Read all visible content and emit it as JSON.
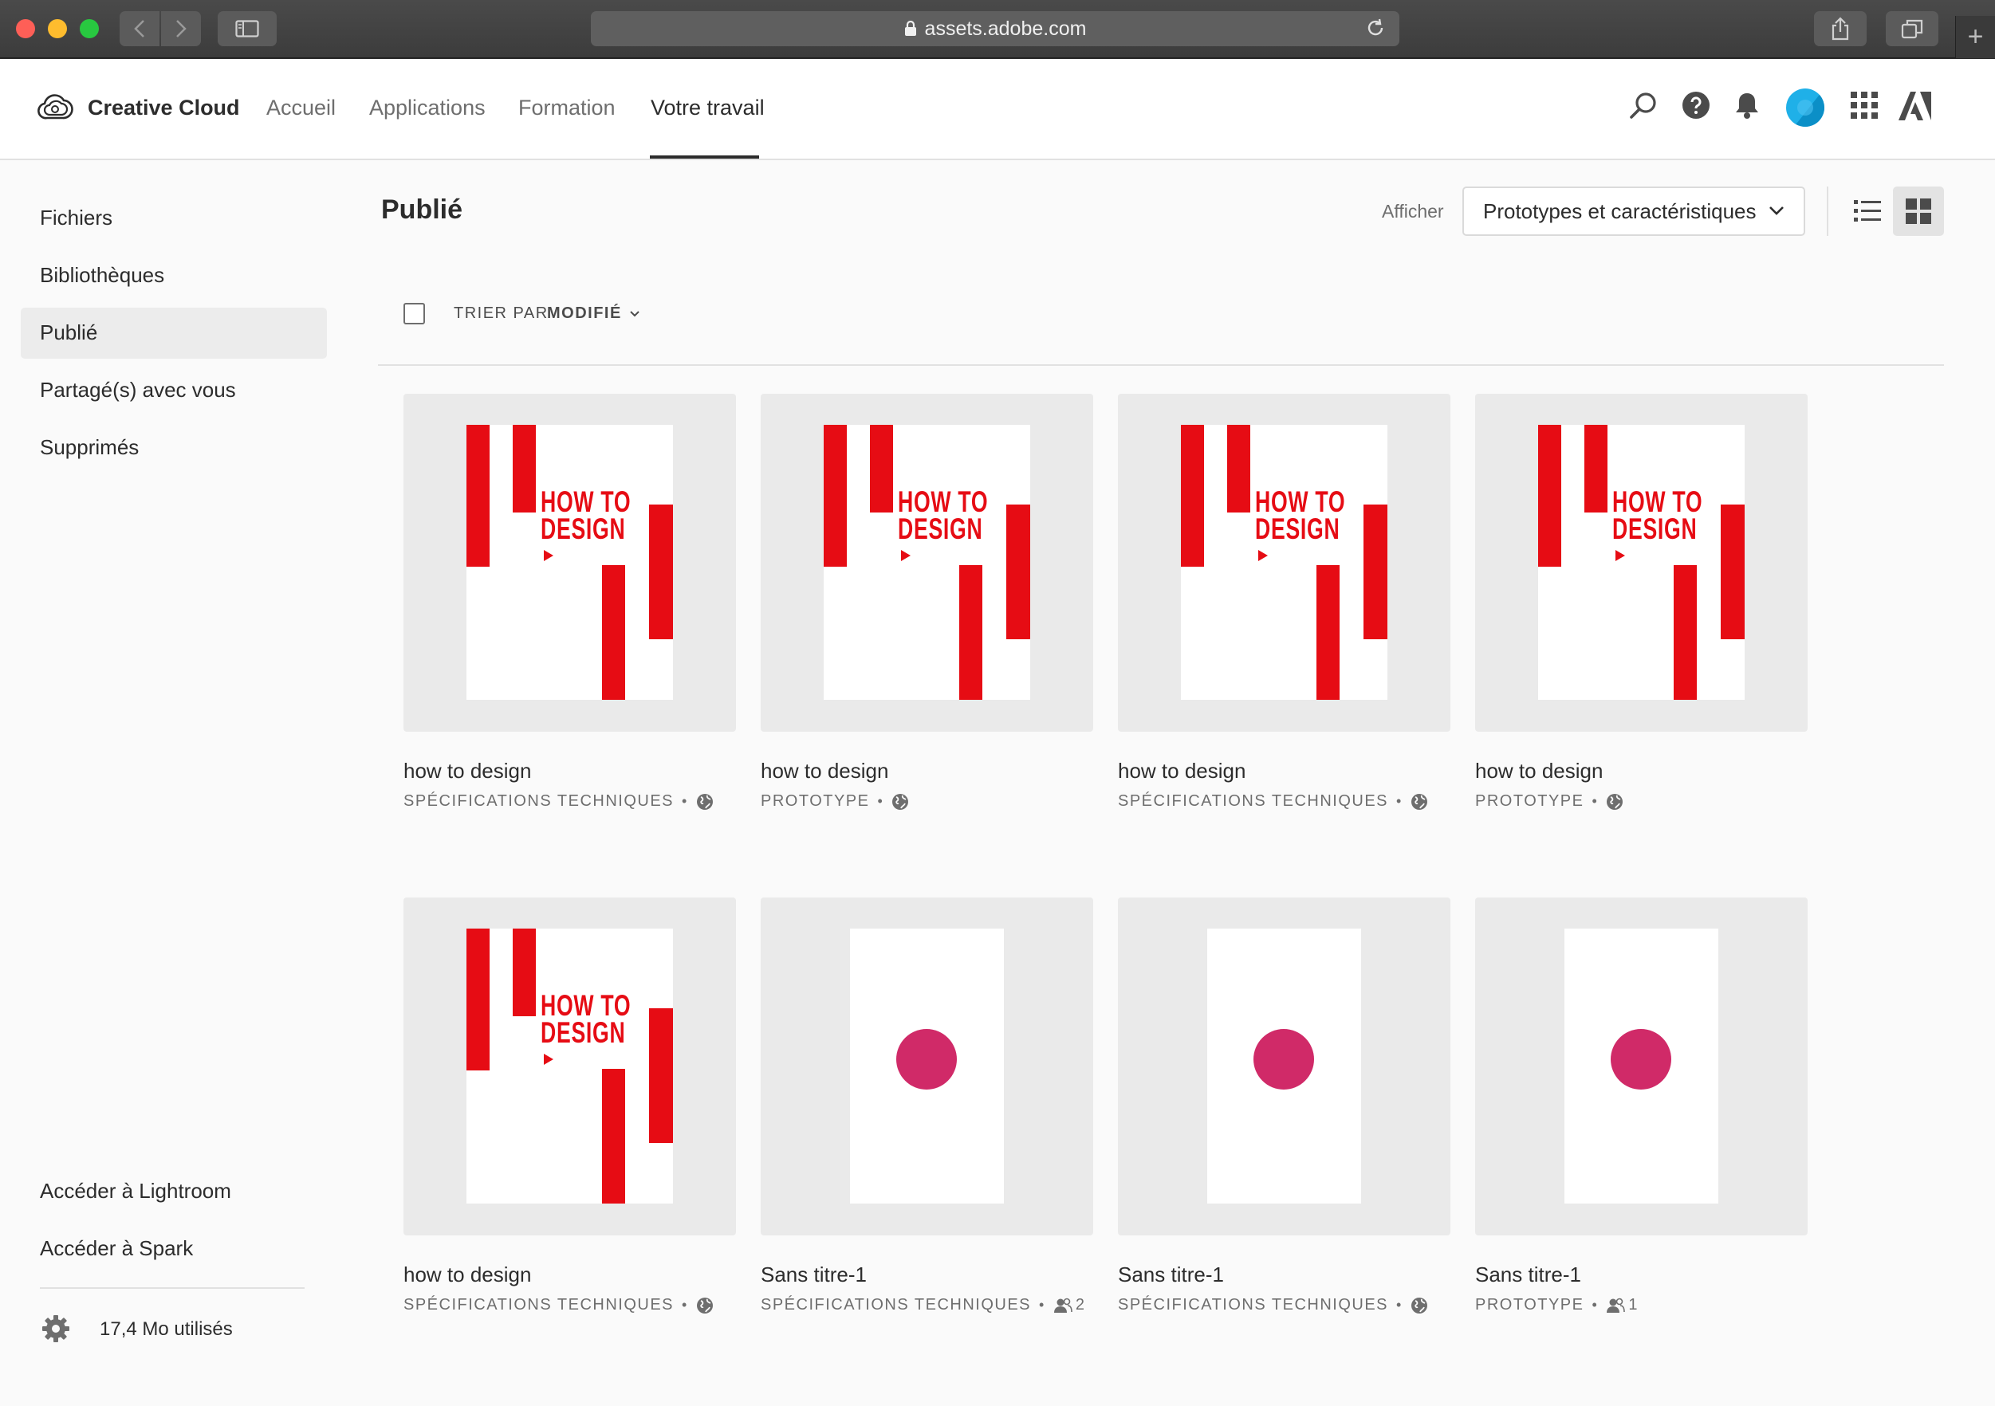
{
  "browser": {
    "url": "assets.adobe.com"
  },
  "header": {
    "brand": "Creative Cloud",
    "nav": [
      "Accueil",
      "Applications",
      "Formation",
      "Votre travail"
    ],
    "active_nav": "Votre travail"
  },
  "sidebar": {
    "items": [
      "Fichiers",
      "Bibliothèques",
      "Publié",
      "Partagé(s) avec vous",
      "Supprimés"
    ],
    "active": "Publié",
    "footer_links": [
      "Accéder à Lightroom",
      "Accéder à Spark"
    ],
    "storage": "17,4 Mo utilisés"
  },
  "main": {
    "title": "Publié",
    "filter_label": "Afficher",
    "filter_value": "Prototypes et caractéristiques",
    "sort_label": "TRIER PAR",
    "sort_value": "MODIFIÉ"
  },
  "cards": [
    {
      "title": "how to design",
      "type": "SPÉCIFICATIONS TECHNIQUES",
      "thumb": "poster",
      "access": "globe-icon"
    },
    {
      "title": "how to design",
      "type": "PROTOTYPE",
      "thumb": "poster",
      "access": "globe-icon"
    },
    {
      "title": "how to design",
      "type": "SPÉCIFICATIONS TECHNIQUES",
      "thumb": "poster",
      "access": "globe-icon"
    },
    {
      "title": "how to design",
      "type": "PROTOTYPE",
      "thumb": "poster",
      "access": "globe-icon"
    },
    {
      "title": "how to design",
      "type": "SPÉCIFICATIONS TECHNIQUES",
      "thumb": "poster",
      "access": "globe-icon"
    },
    {
      "title": "Sans titre-1",
      "type": "SPÉCIFICATIONS TECHNIQUES",
      "thumb": "dot",
      "access": "people-icon",
      "count": "2"
    },
    {
      "title": "Sans titre-1",
      "type": "SPÉCIFICATIONS TECHNIQUES",
      "thumb": "dot",
      "access": "globe-icon"
    },
    {
      "title": "Sans titre-1",
      "type": "PROTOTYPE",
      "thumb": "dot",
      "access": "people-icon",
      "count": "1"
    }
  ],
  "poster_text": [
    "HOW TO",
    "DESIGN"
  ],
  "colors": {
    "accent_red": "#e60c14",
    "dot_pink": "#d02a68",
    "avatar_blue": "#1fb0e8"
  }
}
